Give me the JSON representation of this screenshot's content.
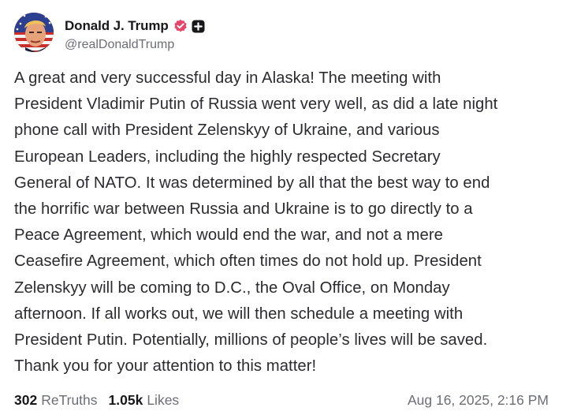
{
  "author": {
    "display_name": "Donald J. Trump",
    "handle": "@realDonaldTrump",
    "avatar_icon": "patriotic-portrait-avatar",
    "verified_icon": "verified-badge-icon",
    "verified_color": "#e6466b",
    "extra_badge_icon": "plus-badge-icon"
  },
  "post": {
    "lines": [
      "A great and very successful day in Alaska! The meeting with",
      "President Vladimir Putin of Russia went very well, as did a late night",
      "phone call with President Zelenskyy of Ukraine, and various",
      "European Leaders, including the highly respected Secretary",
      "General of NATO. It was determined by all that the best way to end",
      "the horrific war between Russia and Ukraine is to go directly to a",
      "Peace Agreement, which would end the war, and not a mere",
      "Ceasefire Agreement, which often times do not hold up. President",
      "Zelenskyy will be coming to D.C., the Oval Office, on Monday",
      "afternoon. If all works out, we will then schedule a meeting with",
      "President Putin. Potentially, millions of people’s lives will be saved.",
      "Thank you for your attention to this matter!"
    ]
  },
  "stats": {
    "retruths_count": "302",
    "retruths_label": "ReTruths",
    "likes_count": "1.05k",
    "likes_label": "Likes"
  },
  "timestamp": "Aug 16, 2025, 2:16 PM"
}
